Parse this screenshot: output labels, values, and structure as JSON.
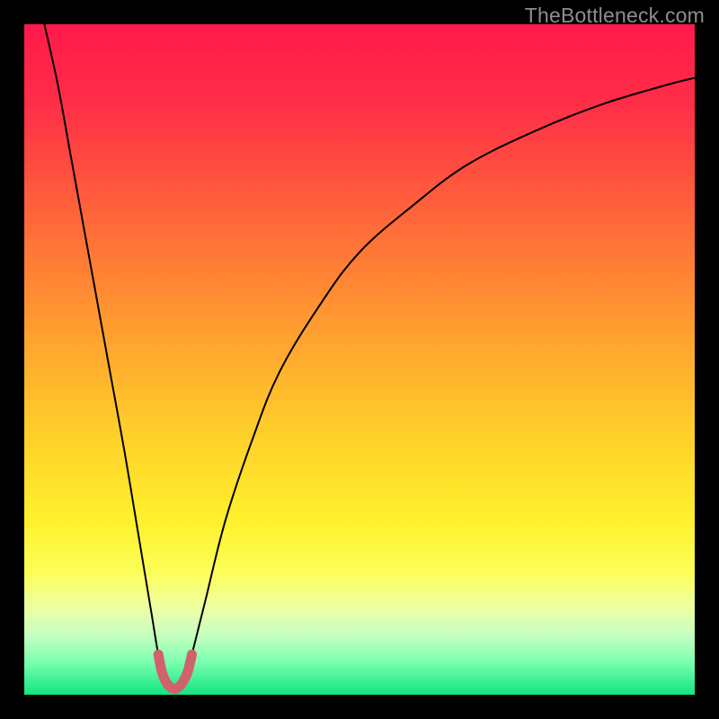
{
  "watermark": "TheBottleneck.com",
  "chart_data": {
    "type": "line",
    "title": "",
    "xlabel": "",
    "ylabel": "",
    "xlim": [
      0,
      100
    ],
    "ylim": [
      0,
      100
    ],
    "grid": false,
    "legend": false,
    "background_gradient": {
      "stops": [
        {
          "offset": 0.0,
          "color": "#ff1a4b"
        },
        {
          "offset": 0.12,
          "color": "#ff2e47"
        },
        {
          "offset": 0.3,
          "color": "#ff6a39"
        },
        {
          "offset": 0.48,
          "color": "#ffa62e"
        },
        {
          "offset": 0.62,
          "color": "#ffd22a"
        },
        {
          "offset": 0.74,
          "color": "#fff02c"
        },
        {
          "offset": 0.82,
          "color": "#fcff5a"
        },
        {
          "offset": 0.87,
          "color": "#edffa2"
        },
        {
          "offset": 0.91,
          "color": "#c7ffc0"
        },
        {
          "offset": 0.95,
          "color": "#7dffb0"
        },
        {
          "offset": 1.0,
          "color": "#11e57f"
        }
      ]
    },
    "series": [
      {
        "name": "bottleneck-curve",
        "stroke": "#000000",
        "stroke_width": 2,
        "x": [
          3,
          5,
          7,
          9,
          11,
          13,
          15,
          17,
          19,
          20,
          21,
          22,
          23,
          24,
          25,
          27,
          30,
          34,
          38,
          44,
          50,
          58,
          66,
          76,
          86,
          96,
          100
        ],
        "y": [
          100,
          91,
          80,
          69,
          58,
          47,
          36,
          24,
          12,
          6,
          2,
          0.5,
          0.5,
          2,
          6,
          14,
          26,
          38,
          48,
          58,
          66,
          73,
          79,
          84,
          88,
          91,
          92
        ]
      },
      {
        "name": "trough-marker",
        "stroke": "#d1616b",
        "stroke_width": 11,
        "linecap": "round",
        "x": [
          20.0,
          20.5,
          21.2,
          22.0,
          22.8,
          23.6,
          24.4,
          25.0
        ],
        "y": [
          6.0,
          3.5,
          1.8,
          1.0,
          1.0,
          1.8,
          3.5,
          6.0
        ]
      }
    ]
  }
}
